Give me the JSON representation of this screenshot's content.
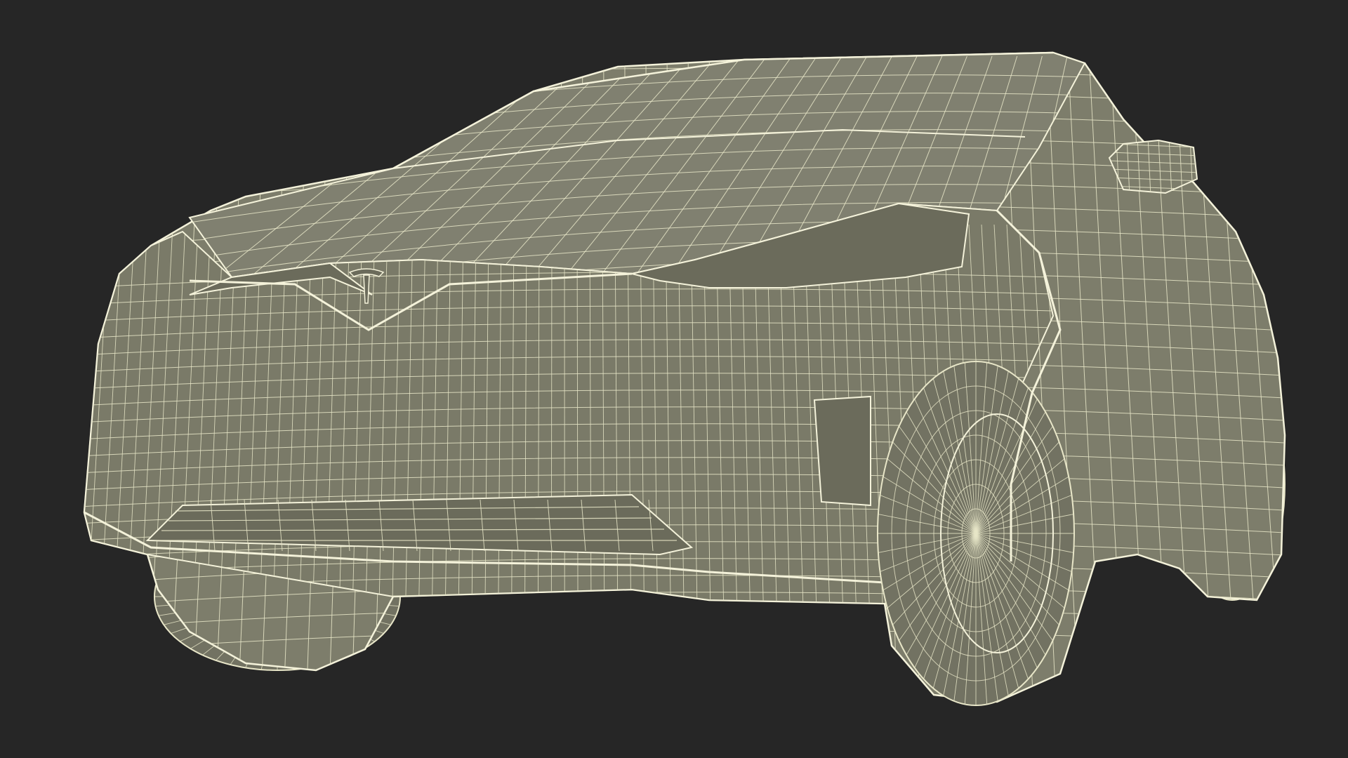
{
  "scene": {
    "background_color": "#262626",
    "subject": "wireframe-car-model",
    "colors": {
      "body_fill": "#7d7d6b",
      "body_fill_dark": "#6b6b5b",
      "body_fill_light": "#8a8a77",
      "wire": "#e8e6c8",
      "wire_strong": "#f4f2da",
      "tire_fill": "#727262",
      "shadow": "#55554a"
    },
    "icons": {
      "emblem": "brand-emblem-icon"
    }
  }
}
